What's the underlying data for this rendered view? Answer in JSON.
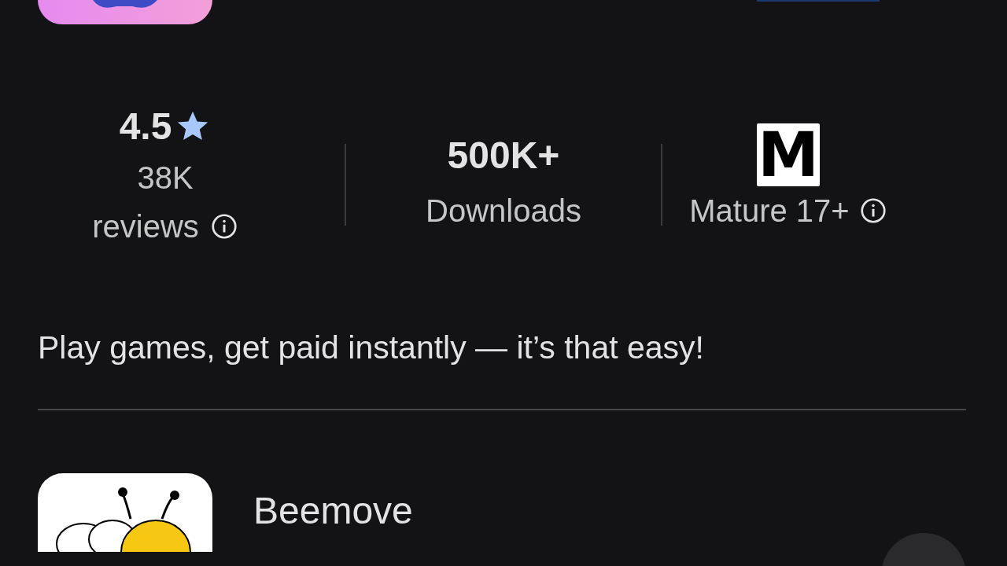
{
  "stats": [
    {
      "kind": "rating",
      "value": "4.5",
      "label": "38K reviews",
      "info": true
    },
    {
      "kind": "plain",
      "value": "500K+",
      "label": "Downloads",
      "info": false
    },
    {
      "kind": "content_rating",
      "badge": "M",
      "label": "Mature 17+",
      "info": true
    }
  ],
  "description": "Play games, get paid instantly — it’s that easy!",
  "next_app": {
    "name": "Beemove"
  }
}
